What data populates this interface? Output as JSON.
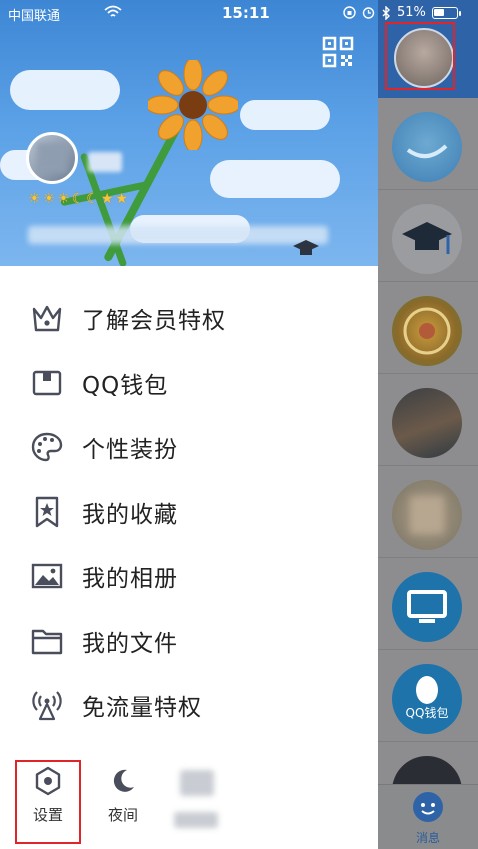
{
  "status_bar": {
    "carrier": "中国联通",
    "time": "15:11",
    "battery_percent_text": "51%",
    "battery_level": 0.51
  },
  "profile": {
    "level_badges": [
      "☀",
      "☀",
      "☀",
      "☾",
      "☾",
      "★",
      "★"
    ]
  },
  "menu": {
    "items": [
      {
        "label": "了解会员特权",
        "icon": "crown-icon"
      },
      {
        "label": "QQ钱包",
        "icon": "wallet-icon"
      },
      {
        "label": "个性装扮",
        "icon": "palette-icon"
      },
      {
        "label": "我的收藏",
        "icon": "bookmark-star-icon"
      },
      {
        "label": "我的相册",
        "icon": "photo-album-icon"
      },
      {
        "label": "我的文件",
        "icon": "folder-icon"
      },
      {
        "label": "免流量特权",
        "icon": "signal-tower-icon"
      }
    ]
  },
  "bottom_bar": {
    "settings_label": "设置",
    "night_label": "夜间"
  },
  "right_strip": {
    "wallet_avatar_text": "QQ钱包",
    "messages_tab_label": "消息"
  },
  "colors": {
    "accent_blue": "#2f63a8",
    "highlight_red": "#e0242a",
    "icon_gray": "#4a4e5c"
  }
}
